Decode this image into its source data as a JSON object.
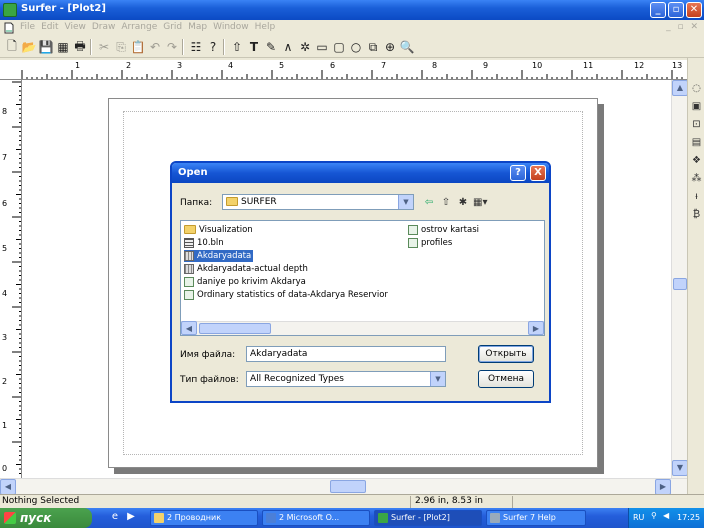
{
  "window": {
    "title": "Surfer - [Plot2]"
  },
  "menu": {
    "items": [
      "File",
      "Edit",
      "View",
      "Draw",
      "Arrange",
      "Grid",
      "Map",
      "Window",
      "Help"
    ]
  },
  "rulers": {
    "horizontal_labels": [
      "1",
      "2",
      "3",
      "4",
      "5",
      "6",
      "7",
      "8",
      "9",
      "10",
      "11",
      "12",
      "13"
    ],
    "vertical_labels": [
      "8",
      "7",
      "6",
      "5",
      "4",
      "3",
      "2",
      "1",
      "0"
    ]
  },
  "dialog": {
    "title": "Open",
    "look_in_label": "Папка:",
    "look_in_value": "SURFER",
    "files": [
      {
        "name": "Visualization",
        "icon": "folder-icon",
        "selected": false
      },
      {
        "name": "10.bln",
        "icon": "bln-file-icon",
        "selected": false
      },
      {
        "name": "Akdaryadata",
        "icon": "grid-file-icon",
        "selected": true
      },
      {
        "name": "Akdaryadata-actual depth",
        "icon": "grid-file-icon",
        "selected": false
      },
      {
        "name": "daniye po krivim Akdarya",
        "icon": "data-file-icon",
        "selected": false
      },
      {
        "name": "Ordinary statistics of data-Akdarya Reservior",
        "icon": "data-file-icon",
        "selected": false
      },
      {
        "name": "ostrov kartasi",
        "icon": "data-file-icon",
        "selected": false
      },
      {
        "name": "profiles",
        "icon": "data-file-icon",
        "selected": false
      }
    ],
    "filename_label": "Имя файла:",
    "filename_value": "Akdaryadata",
    "filetype_label": "Тип файлов:",
    "filetype_value": "All Recognized Types",
    "open_button": "Открыть",
    "cancel_button": "Отмена",
    "help_button": "?",
    "close_button": "X"
  },
  "status": {
    "left": "Nothing Selected",
    "coords": "2.96 in, 8.53 in"
  },
  "taskbar": {
    "start": "пуск",
    "tasks": [
      {
        "label": "2 Проводник",
        "active": false
      },
      {
        "label": "2 Microsoft O...",
        "active": false
      },
      {
        "label": "Surfer - [Plot2]",
        "active": true
      },
      {
        "label": "Surfer 7 Help",
        "active": false
      }
    ],
    "lang": "RU",
    "clock": "17:25"
  }
}
